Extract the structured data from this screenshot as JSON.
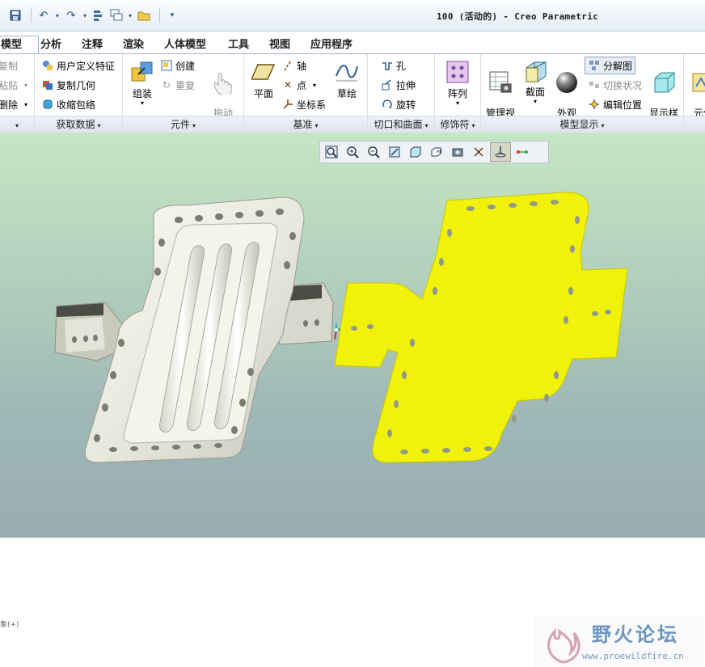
{
  "window": {
    "title": "100 (活动的) - Creo Parametric"
  },
  "quick_access": {
    "icons": [
      "save-icon",
      "undo-icon",
      "redo-icon",
      "regenerate-icon",
      "windows-icon",
      "open-folder-icon",
      "customize-icon"
    ]
  },
  "tabs": [
    {
      "label": "模型",
      "active": true
    },
    {
      "label": "分析"
    },
    {
      "label": "注释"
    },
    {
      "label": "渲染"
    },
    {
      "label": "人体模型"
    },
    {
      "label": "工具"
    },
    {
      "label": "视图"
    },
    {
      "label": "应用程序"
    }
  ],
  "ribbon": {
    "operations": {
      "items": [
        "复制",
        "粘贴",
        "删除"
      ]
    },
    "get_data": {
      "label": "获取数据",
      "items": [
        "用户定义特征",
        "复制几何",
        "收缩包络"
      ]
    },
    "component": {
      "label": "元件",
      "assemble": "组装",
      "create": "创建",
      "repeat": "重复",
      "drag": "拖动\n元件"
    },
    "datum": {
      "label": "基准",
      "plane": "平面",
      "axis": "轴",
      "point": "点",
      "csys": "坐标系",
      "sketch": "草绘"
    },
    "cut_surface": {
      "label": "切口和曲面",
      "hole": "孔",
      "extrude": "拉伸",
      "revolve": "旋转"
    },
    "modifiers": {
      "label": "修饰符",
      "pattern": "阵列"
    },
    "model_display": {
      "label": "模型显示",
      "manage_views": "管理视\n图",
      "section": "截面",
      "appearance": "外观\n库",
      "explode": "分解图",
      "toggle_state": "切换状况",
      "edit_position": "编辑位置",
      "display_style": "显示样\n式",
      "component_interface": "元件\n界面"
    }
  },
  "viewport": {
    "background_top": "#c5e6c3",
    "background_bottom": "#98adb2",
    "part_color": "#f0f0e8",
    "flat_color": "#f1f10a",
    "status_text": "象(+)"
  },
  "view_toolbar": {
    "icons": [
      "refit-icon",
      "zoom-in-icon",
      "zoom-out-icon",
      "repaint-icon",
      "display-style-icon",
      "saved-views-icon",
      "view-manager-icon",
      "datum-display-icon",
      "spin-center-icon",
      "annotation-display-icon"
    ]
  },
  "watermark": {
    "text": "野火论坛",
    "url": "www.proewildfire.cn"
  }
}
